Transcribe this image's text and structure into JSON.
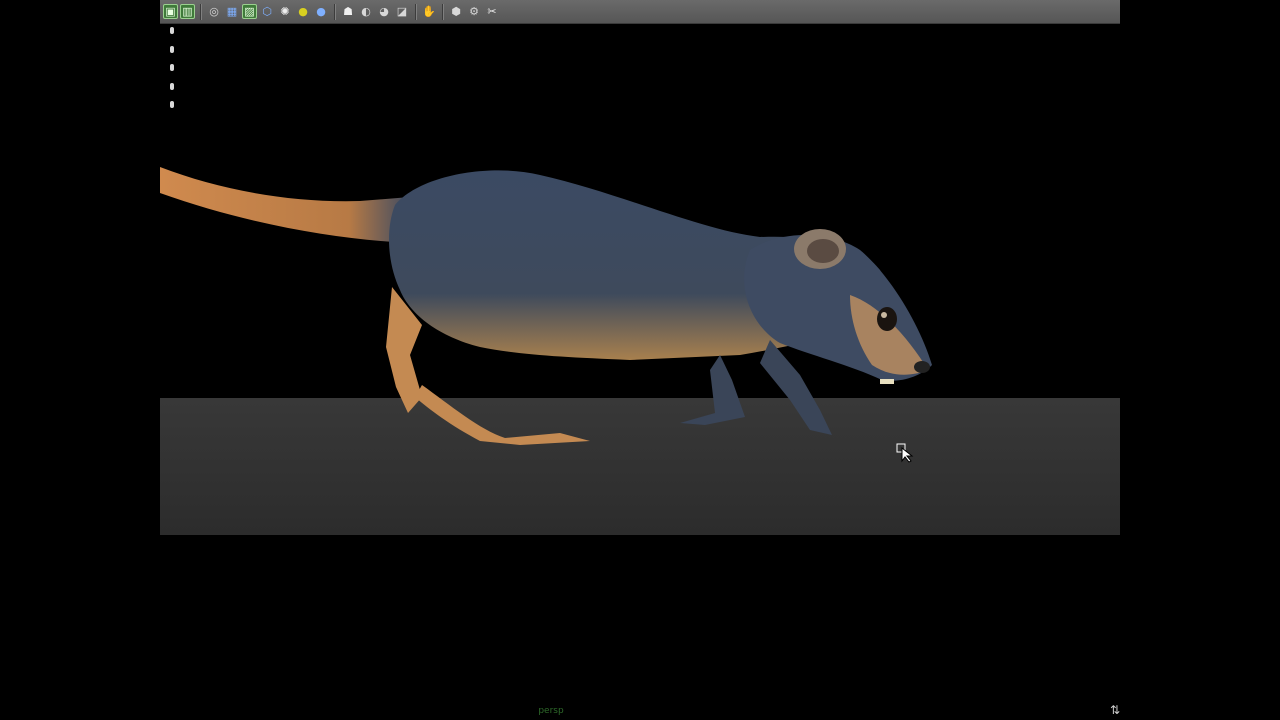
{
  "toolbar": {
    "tools": [
      {
        "name": "select-mode-icon",
        "glyph": "▣"
      },
      {
        "name": "hide-icon",
        "glyph": "▥"
      },
      {
        "name": "camera-attributes-icon",
        "glyph": "◎"
      },
      {
        "name": "grid-icon",
        "glyph": "▦"
      },
      {
        "name": "bookmark-icon",
        "glyph": "▨"
      },
      {
        "name": "wireframe-cube-icon",
        "glyph": "⬡"
      },
      {
        "name": "shaded-sphere-icon",
        "glyph": "✺"
      },
      {
        "name": "light-icon",
        "glyph": "●"
      },
      {
        "name": "smooth-shade-icon",
        "glyph": "●"
      },
      {
        "name": "isolate-select-icon",
        "glyph": "☗"
      },
      {
        "name": "xray-icon",
        "glyph": "◐"
      },
      {
        "name": "shadows-icon",
        "glyph": "◕"
      },
      {
        "name": "textured-icon",
        "glyph": "◪"
      },
      {
        "name": "manipulator-icon",
        "glyph": "✋"
      },
      {
        "name": "joint-xray-icon",
        "glyph": "⬢"
      },
      {
        "name": "ambient-occlusion-icon",
        "glyph": "⚙"
      },
      {
        "name": "motion-blur-icon",
        "glyph": "✂"
      }
    ]
  },
  "viewport": {
    "camera_label": "persp",
    "axis_glyph": "⇅",
    "ground_color": "#333333",
    "fur_color": "#3b4a63",
    "skin_color": "#c48a52"
  }
}
